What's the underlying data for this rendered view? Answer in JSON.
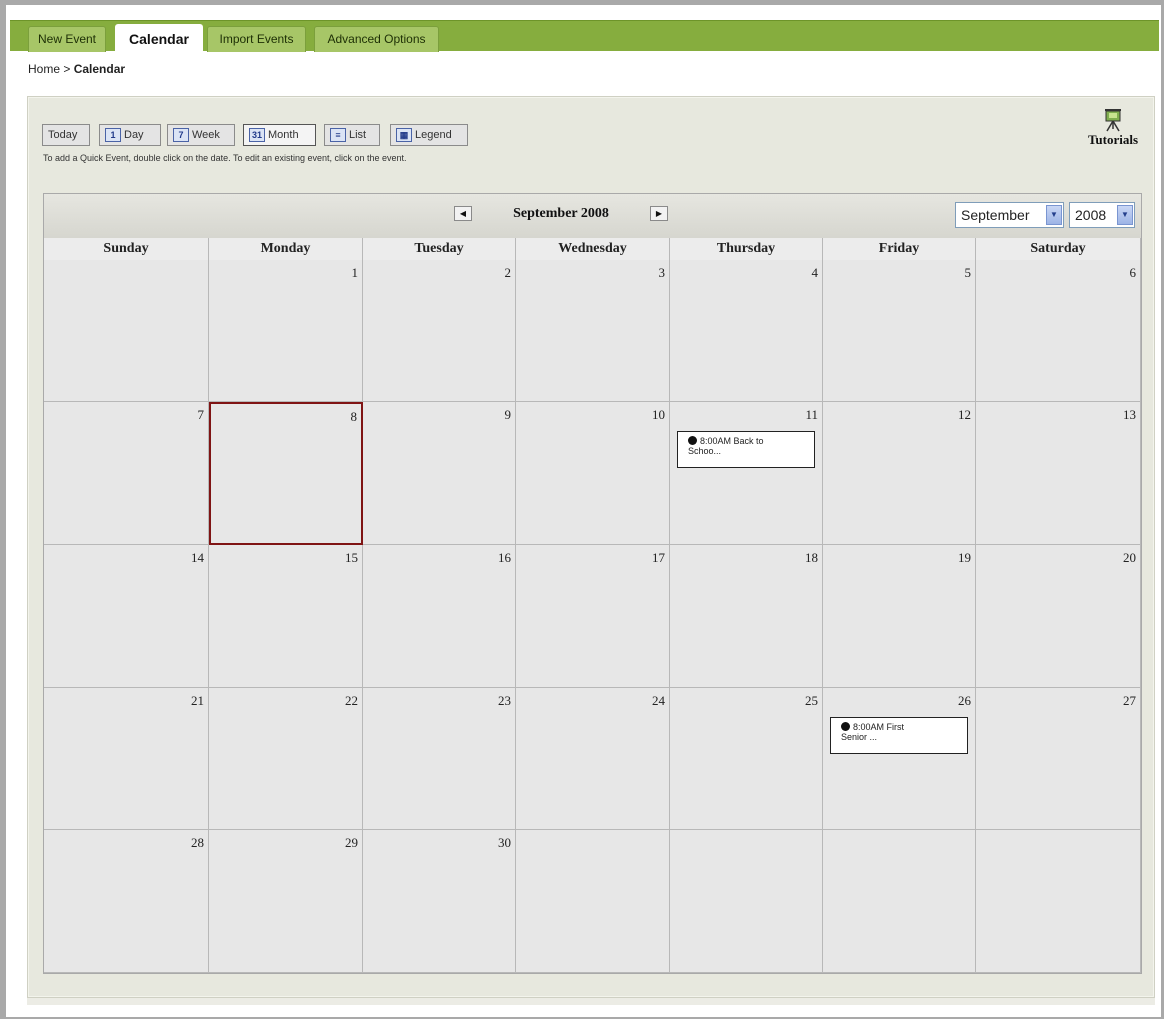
{
  "tabs": [
    {
      "label": "New Event",
      "active": false
    },
    {
      "label": "Calendar",
      "active": true
    },
    {
      "label": "Import Events",
      "active": false
    },
    {
      "label": "Advanced Options",
      "active": false
    }
  ],
  "breadcrumb": {
    "home": "Home",
    "sep": " > ",
    "current": "Calendar"
  },
  "views": [
    {
      "label": "Today",
      "icon": "",
      "icon_name": ""
    },
    {
      "label": "Day",
      "icon": "1",
      "icon_name": "day-icon"
    },
    {
      "label": "Week",
      "icon": "7",
      "icon_name": "week-icon"
    },
    {
      "label": "Month",
      "icon": "31",
      "icon_name": "month-icon",
      "active": true
    },
    {
      "label": "List",
      "icon": "≡",
      "icon_name": "list-icon"
    },
    {
      "label": "Legend",
      "icon": "▦",
      "icon_name": "legend-icon"
    }
  ],
  "hint": "To add a Quick Event, double click on the date. To edit an existing event, click on the event.",
  "tutorials": {
    "label": "Tutorials",
    "icon": "easel-icon"
  },
  "calendar": {
    "month_title": "September 2008",
    "month_select": "September",
    "year_select": "2008",
    "days_of_week": [
      "Sunday",
      "Monday",
      "Tuesday",
      "Wednesday",
      "Thursday",
      "Friday",
      "Saturday"
    ],
    "weeks": [
      [
        "",
        "1",
        "2",
        "3",
        "4",
        "5",
        "6"
      ],
      [
        "7",
        "8",
        "9",
        "10",
        "11",
        "12",
        "13"
      ],
      [
        "14",
        "15",
        "16",
        "17",
        "18",
        "19",
        "20"
      ],
      [
        "21",
        "22",
        "23",
        "24",
        "25",
        "26",
        "27"
      ],
      [
        "28",
        "29",
        "30",
        "",
        "",
        "",
        ""
      ]
    ],
    "today": "8",
    "events": [
      {
        "day": "11",
        "line1": "8:00AM Back to",
        "line2": "Schoo..."
      },
      {
        "day": "26",
        "line1": "8:00AM First",
        "line2": "Senior ..."
      }
    ]
  },
  "colors": {
    "tabbar": "#86ad3e",
    "today_border": "#7f1414",
    "cell_bg": "#e7e7e7"
  }
}
